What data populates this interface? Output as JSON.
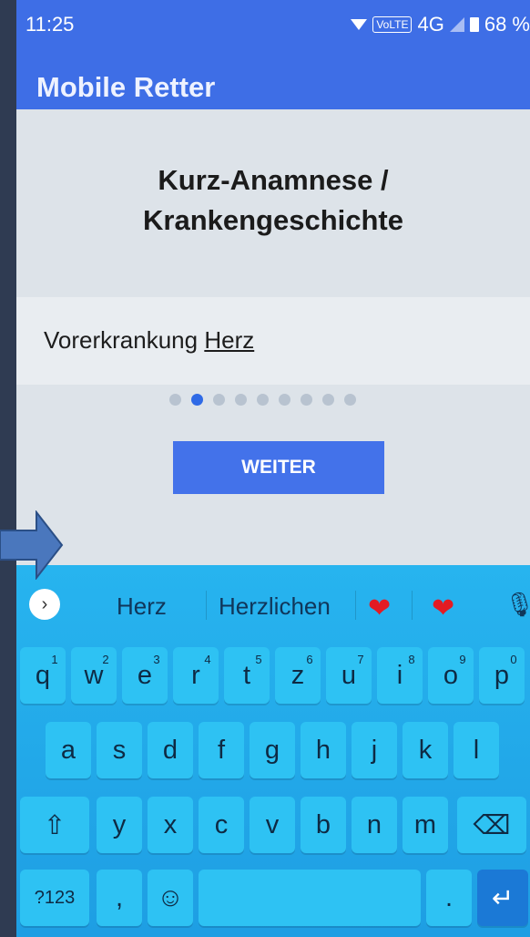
{
  "status": {
    "time": "11:25",
    "network": "VoLTE",
    "net_type": "4G",
    "battery": "68 %"
  },
  "app": {
    "title": "Mobile Retter"
  },
  "main": {
    "heading_line1": "Kurz-Anamnese /",
    "heading_line2": "Krankengeschichte",
    "question_prefix": "Vorerkrankung ",
    "question_word": "Herz",
    "pager": {
      "total": 9,
      "active": 2
    },
    "button": "WEITER"
  },
  "keyboard": {
    "suggestions": [
      "Herz",
      "Herzlichen"
    ],
    "row1": [
      {
        "k": "q",
        "n": "1"
      },
      {
        "k": "w",
        "n": "2"
      },
      {
        "k": "e",
        "n": "3"
      },
      {
        "k": "r",
        "n": "4"
      },
      {
        "k": "t",
        "n": "5"
      },
      {
        "k": "z",
        "n": "6"
      },
      {
        "k": "u",
        "n": "7"
      },
      {
        "k": "i",
        "n": "8"
      },
      {
        "k": "o",
        "n": "9"
      },
      {
        "k": "p",
        "n": "0"
      }
    ],
    "row2": [
      "a",
      "s",
      "d",
      "f",
      "g",
      "h",
      "j",
      "k",
      "l"
    ],
    "row3": [
      "y",
      "x",
      "c",
      "v",
      "b",
      "n",
      "m"
    ],
    "symbols_label": "?123",
    "comma": ",",
    "period": "."
  },
  "colors": {
    "app_bar": "#3e6ee6",
    "button": "#4372ea",
    "keyboard": "#27b4ef",
    "active_dot": "#2f6ae6"
  }
}
